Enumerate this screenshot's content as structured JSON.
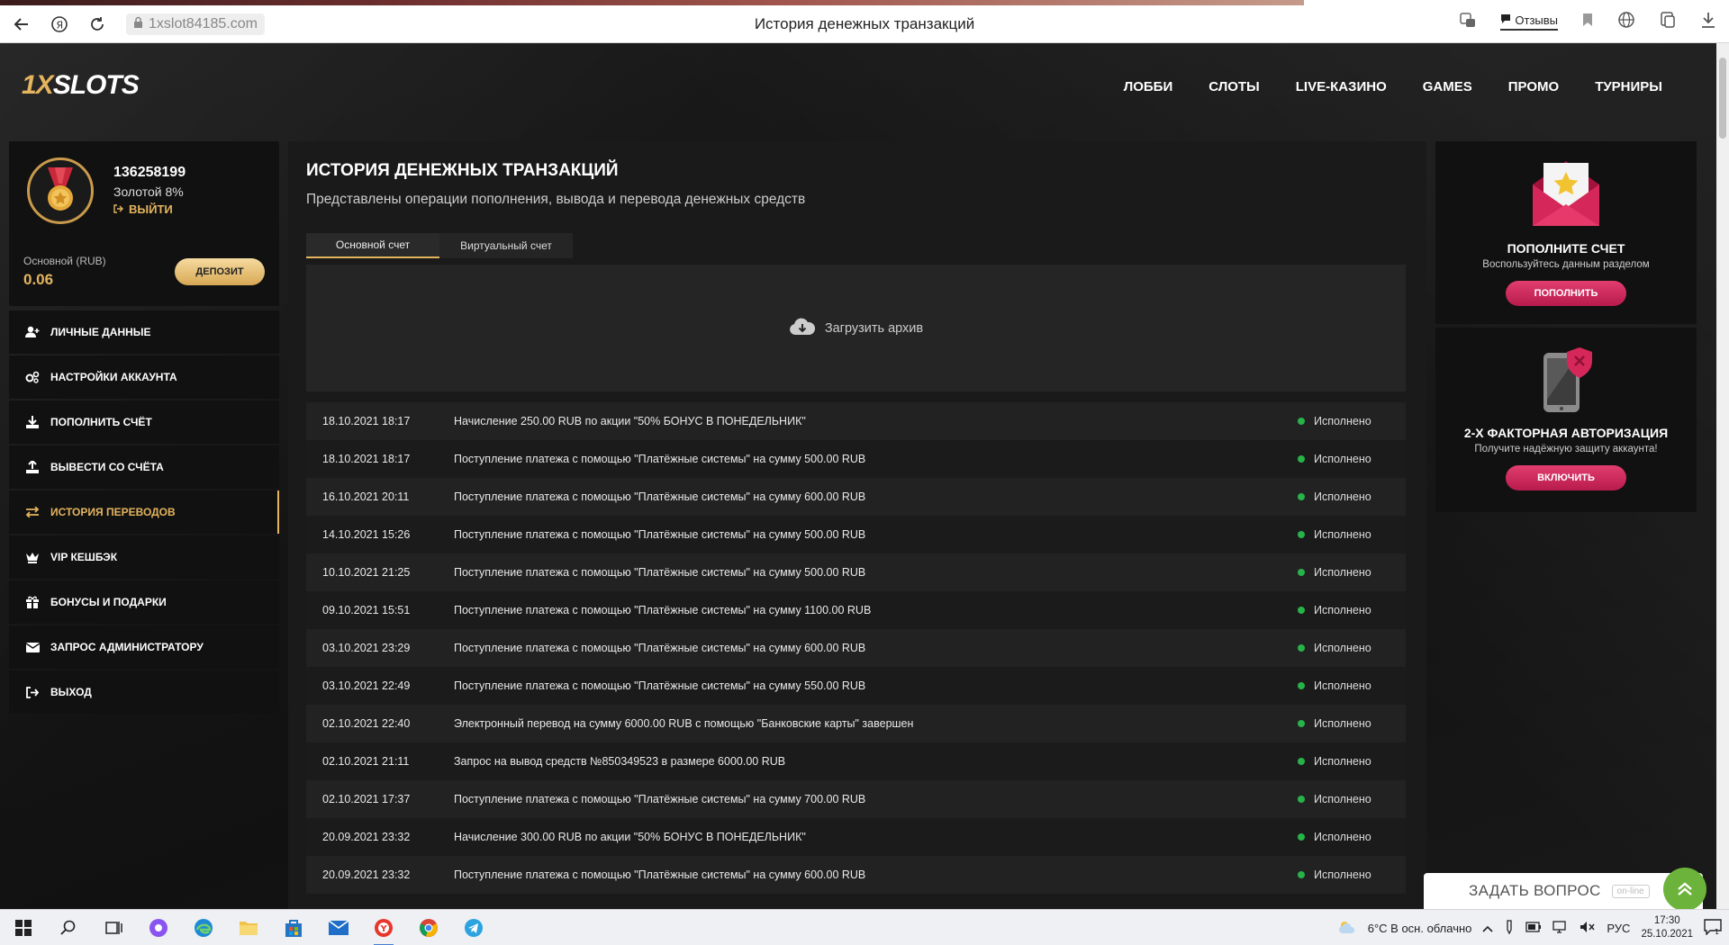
{
  "browser": {
    "url": "1xslot84185.com",
    "page_title": "История денежных транзакций",
    "reviews_label": "Отзывы"
  },
  "header": {
    "logo_prefix": "1X",
    "logo_main": "SLOTS",
    "nav": [
      "ЛОББИ",
      "СЛОТЫ",
      "LIVE-КАЗИНО",
      "GAMES",
      "ПРОМО",
      "ТУРНИРЫ"
    ]
  },
  "profile": {
    "id": "136258199",
    "level": "Золотой 8%",
    "logout_label": "ВЫЙТИ",
    "balance_label": "Основной (RUB)",
    "balance_value": "0.06",
    "deposit_label": "ДЕПОЗИТ"
  },
  "side_menu": [
    {
      "label": "ЛИЧНЫЕ ДАННЫЕ",
      "icon": "user-plus-icon"
    },
    {
      "label": "НАСТРОЙКИ АККАУНТА",
      "icon": "gears-icon"
    },
    {
      "label": "ПОПОЛНИТЬ СЧЁТ",
      "icon": "download-icon"
    },
    {
      "label": "ВЫВЕСТИ СО СЧЁТА",
      "icon": "upload-icon"
    },
    {
      "label": "ИСТОРИЯ ПЕРЕВОДОВ",
      "icon": "exchange-icon",
      "active": true
    },
    {
      "label": "VIP КЕШБЭК",
      "icon": "crown-icon"
    },
    {
      "label": "БОНУСЫ И ПОДАРКИ",
      "icon": "gift-icon"
    },
    {
      "label": "ЗАПРОС АДМИНИСТРАТОРУ",
      "icon": "envelope-icon"
    },
    {
      "label": "ВЫХОД",
      "icon": "sign-out-icon"
    }
  ],
  "main": {
    "title": "ИСТОРИЯ ДЕНЕЖНЫХ ТРАНЗАКЦИЙ",
    "subtitle": "Представлены операции пополнения, вывода и перевода денежных средств",
    "tabs": [
      "Основной счет",
      "Виртуальный счет"
    ],
    "archive_label": "Загрузить архив",
    "transactions": [
      {
        "date": "18.10.2021 18:17",
        "desc": "Начисление 250.00 RUB по акции \"50% БОНУС В ПОНЕДЕЛЬНИК\"",
        "status": "Исполнено"
      },
      {
        "date": "18.10.2021 18:17",
        "desc": "Поступление платежа с помощью \"Платёжные системы\" на сумму 500.00 RUB",
        "status": "Исполнено"
      },
      {
        "date": "16.10.2021 20:11",
        "desc": "Поступление платежа с помощью \"Платёжные системы\" на сумму 600.00 RUB",
        "status": "Исполнено"
      },
      {
        "date": "14.10.2021 15:26",
        "desc": "Поступление платежа с помощью \"Платёжные системы\" на сумму 500.00 RUB",
        "status": "Исполнено"
      },
      {
        "date": "10.10.2021 21:25",
        "desc": "Поступление платежа с помощью \"Платёжные системы\" на сумму 500.00 RUB",
        "status": "Исполнено"
      },
      {
        "date": "09.10.2021 15:51",
        "desc": "Поступление платежа с помощью \"Платёжные системы\" на сумму 1100.00 RUB",
        "status": "Исполнено"
      },
      {
        "date": "03.10.2021 23:29",
        "desc": "Поступление платежа с помощью \"Платёжные системы\" на сумму 600.00 RUB",
        "status": "Исполнено"
      },
      {
        "date": "03.10.2021 22:49",
        "desc": "Поступление платежа с помощью \"Платёжные системы\" на сумму 550.00 RUB",
        "status": "Исполнено"
      },
      {
        "date": "02.10.2021 22:40",
        "desc": "Электронный перевод на сумму 6000.00 RUB с помощью \"Банковские карты\" завершен",
        "status": "Исполнено"
      },
      {
        "date": "02.10.2021 21:11",
        "desc": "Запрос на вывод средств №850349523 в размере 6000.00 RUB",
        "status": "Исполнено"
      },
      {
        "date": "02.10.2021 17:37",
        "desc": "Поступление платежа с помощью \"Платёжные системы\" на сумму 700.00 RUB",
        "status": "Исполнено"
      },
      {
        "date": "20.09.2021 23:32",
        "desc": "Начисление 300.00 RUB по акции \"50% БОНУС В ПОНЕДЕЛЬНИК\"",
        "status": "Исполнено"
      },
      {
        "date": "20.09.2021 23:32",
        "desc": "Поступление платежа с помощью \"Платёжные системы\" на сумму 600.00 RUB",
        "status": "Исполнено"
      }
    ]
  },
  "widgets": [
    {
      "title": "ПОПОЛНИТЕ СЧЕТ",
      "desc": "Воспользуйтесь данным разделом",
      "button": "ПОПОЛНИТЬ",
      "icon": "envelope-star-icon"
    },
    {
      "title": "2-Х ФАКТОРНАЯ АВТОРИЗАЦИЯ",
      "desc": "Получите надёжную защиту аккаунта!",
      "button": "ВКЛЮЧИТЬ",
      "icon": "phone-shield-icon"
    }
  ],
  "chat": {
    "label": "ЗАДАТЬ ВОПРОС",
    "badge": "on-line"
  },
  "taskbar": {
    "weather": "6°C  В осн. облачно",
    "lang": "РУС",
    "time": "17:30",
    "date": "25.10.2021"
  },
  "colors": {
    "accent_gold": "#e4b45e",
    "accent_pink": "#d62f62",
    "status_green": "#27b24a"
  }
}
